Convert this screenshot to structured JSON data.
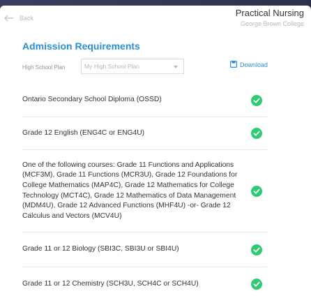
{
  "header": {
    "back_label": "Back",
    "title": "Practical Nursing",
    "subtitle": "George Brown College"
  },
  "section": {
    "title": "Admission Requirements"
  },
  "plan": {
    "label": "High School Plan",
    "placeholder": "My High School Plan",
    "download_label": "Download"
  },
  "requirements": [
    {
      "text": "Ontario Secondary School Diploma (OSSD)",
      "met": true
    },
    {
      "text": "Grade 12 English (ENG4C or ENG4U)",
      "met": true
    },
    {
      "text": "One of the following courses: Grade 11 Functions and Applications (MCF3M), Grade 11 Functions (MCR3U), Grade 12 Foundations for College Mathematics (MAP4C), Grade 12 Mathematics for College Technology (MCT4C), Grade 12 Mathematics of Data Management (MDM4U), Grade 12 Advanced Functions (MHF4U) -or- Grade 12 Calculus and Vectors (MCV4U)",
      "met": true
    },
    {
      "text": "Grade 11 or 12 Biology (SBI3C, SBI3U or SBI4U)",
      "met": true
    },
    {
      "text": "Grade 11 or 12 Chemistry (SCH3U, SCH4C or SCH4U)",
      "met": true
    }
  ],
  "colors": {
    "accent": "#2a8fd6",
    "check_green": "#2ecc71"
  }
}
